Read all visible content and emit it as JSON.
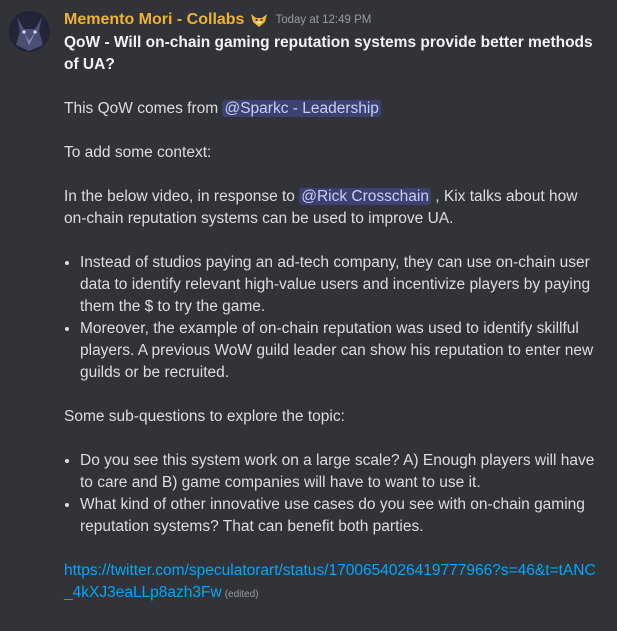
{
  "message": {
    "author": "Memento Mori - Collabs",
    "timestamp": "Today at 12:49 PM",
    "title": "QoW - Will on-chain gaming reputation systems provide better methods of UA?",
    "intro_prefix": "This QoW comes from",
    "intro_mention": "@Sparkc - Leadership",
    "context_label": "To add some context:",
    "video_prefix": "In the below video, in response to",
    "video_mention": "@Rick Crosschain",
    "video_suffix": ", Kix talks about how on-chain reputation systems can be used to improve UA.",
    "bullets": [
      "Instead of studios paying an ad-tech company, they can use on-chain user data to identify relevant high-value users and incentivize players by paying them the $ to try the game.",
      "Moreover, the example of on-chain reputation was used to identify skillful players. A previous WoW guild leader can show his reputation to enter new guilds or be recruited."
    ],
    "sub_label": "Some sub-questions to explore the topic:",
    "sub_bullets": [
      "Do you see this system work on a large scale? A) Enough players will have to care and B) game companies will have to want to use it.",
      "What kind of other innovative use cases do you see with on-chain gaming reputation systems? That can benefit both parties."
    ],
    "link": "https://twitter.com/speculatorart/status/1700654026419777966?s=46&t=tANC_4kXJ3eaLLp8azh3Fw",
    "edited": "(edited)"
  },
  "colors": {
    "background": "#313338",
    "username": "#f0b232",
    "mention_bg": "#3c4270",
    "link": "#00a8fc"
  },
  "icons": {
    "avatar": "wolf-avatar",
    "badge": "fox-badge-icon"
  }
}
